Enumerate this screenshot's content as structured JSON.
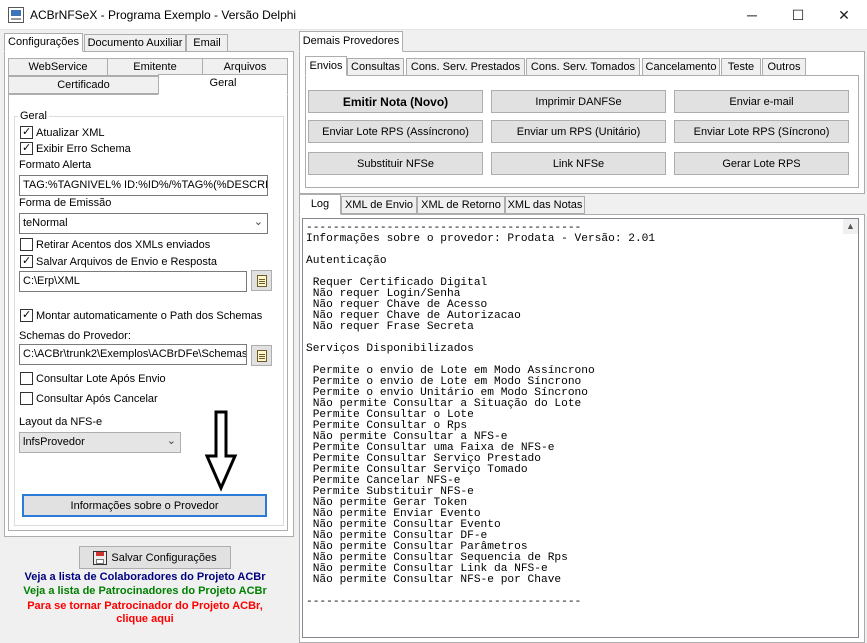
{
  "window": {
    "title": "ACBrNFSeX - Programa Exemplo - Versão Delphi",
    "minimize": "─",
    "maximize": "☐",
    "close": "✕"
  },
  "left_tabs": [
    "Configurações",
    "Documento Auxiliar",
    "Email"
  ],
  "config_tabs_row1": [
    "WebService",
    "Emitente",
    "Arquivos"
  ],
  "config_tabs_row2": [
    "Certificado",
    "Geral"
  ],
  "geral": {
    "group_label": "Geral",
    "atualizar_xml": {
      "label": "Atualizar XML",
      "checked": true
    },
    "exibir_erro_schema": {
      "label": "Exibir Erro Schema",
      "checked": true
    },
    "formato_alerta_label": "Formato Alerta",
    "formato_alerta_value": "TAG:%TAGNIVEL% ID:%ID%/%TAG%(%DESCRI",
    "forma_emissao_label": "Forma de Emissão",
    "forma_emissao_value": "teNormal",
    "retirar_acentos": {
      "label": "Retirar Acentos dos XMLs enviados",
      "checked": false
    },
    "salvar_arquivos": {
      "label": "Salvar Arquivos de Envio e Resposta",
      "checked": true
    },
    "path_value": "C:\\Erp\\XML",
    "montar_path": {
      "label": "Montar automaticamente o Path dos Schemas",
      "checked": true
    },
    "schemas_label": "Schemas do Provedor:",
    "schemas_value": "C:\\ACBr\\trunk2\\Exemplos\\ACBrDFe\\Schemas\\",
    "consultar_lote": {
      "label": "Consultar Lote Após Envio",
      "checked": false
    },
    "consultar_cancelar": {
      "label": "Consultar Após Cancelar",
      "checked": false
    },
    "layout_label": "Layout da NFS-e",
    "layout_value": "lnfsProvedor",
    "info_button": "Informações sobre o Provedor"
  },
  "salvar_config_button": "Salvar Configurações",
  "links": {
    "colaboradores": "Veja a lista de Colaboradores do Projeto ACBr",
    "patrocinadores": "Veja a lista de Patrocinadores do Projeto ACBr",
    "patrocinador_1": "Para se tornar Patrocinador do Projeto ACBr,",
    "patrocinador_2": "clique aqui"
  },
  "colors": {
    "link_blue": "#000080",
    "link_green": "#008000",
    "link_red": "#ff0000",
    "focus_blue": "#2b7bd8"
  },
  "right_top_tab": "Demais Provedores",
  "service_tabs": [
    "Envios",
    "Consultas",
    "Cons. Serv. Prestados",
    "Cons. Serv. Tomados",
    "Cancelamento",
    "Teste",
    "Outros"
  ],
  "envios_buttons": {
    "emitir_nota": "Emitir Nota (Novo)",
    "imprimir_danfse": "Imprimir DANFSe",
    "enviar_email": "Enviar e-mail",
    "enviar_lote_assincrono": "Enviar Lote RPS (Assíncrono)",
    "enviar_rps_unitario": "Enviar um RPS (Unitário)",
    "enviar_lote_sincrono": "Enviar Lote RPS (Síncrono)",
    "substituir_nfse": "Substituir NFSe",
    "link_nfse": "Link NFSe",
    "gerar_lote": "Gerar Lote RPS"
  },
  "log_tabs": [
    "Log",
    "XML de Envio",
    "XML de Retorno",
    "XML das Notas"
  ],
  "log_text": "-----------------------------------------\nInformações sobre o provedor: Prodata - Versão: 2.01\n\nAutenticação\n\n Requer Certificado Digital\n Não requer Login/Senha\n Não requer Chave de Acesso\n Não requer Chave de Autorizacao\n Não requer Frase Secreta\n\nServiços Disponibilizados\n\n Permite o envio de Lote em Modo Assíncrono\n Permite o envio de Lote em Modo Síncrono\n Permite o envio Unitário em Modo Síncrono\n Não permite Consultar a Situação do Lote\n Permite Consultar o Lote\n Permite Consultar o Rps\n Não permite Consultar a NFS-e\n Permite Consultar uma Faixa de NFS-e\n Permite Consultar Serviço Prestado\n Permite Consultar Serviço Tomado\n Permite Cancelar NFS-e\n Permite Substituir NFS-e\n Não permite Gerar Token\n Não permite Enviar Evento\n Não permite Consultar Evento\n Não permite Consultar DF-e\n Não permite Consultar Parâmetros\n Não permite Consultar Sequencia de Rps\n Não permite Consultar Link da NFS-e\n Não permite Consultar NFS-e por Chave\n\n-----------------------------------------"
}
